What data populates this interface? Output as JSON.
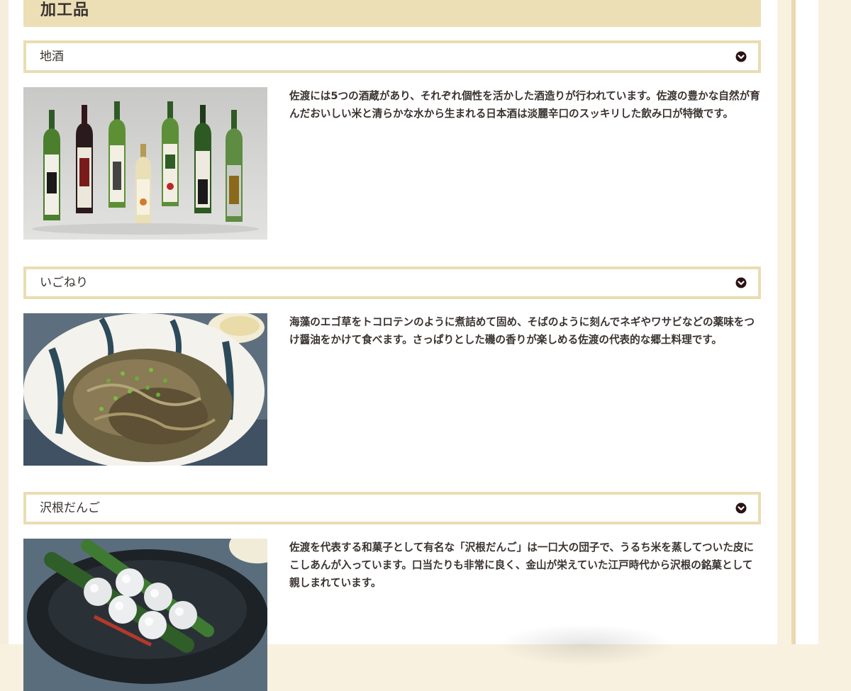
{
  "section": {
    "title": "加工品"
  },
  "items": [
    {
      "title": "地酒",
      "toggle_icon": "chevron-down-circle-icon",
      "image_name": "sake-bottles-photo",
      "description": "佐渡には5つの酒蔵があり、それぞれ個性を活かした酒造りが行われています。佐渡の豊かな自然が育んだおいしい米と清らかな水から生まれる日本酒は淡麗辛口のスッキリした飲み口が特徴です。"
    },
    {
      "title": "いごねり",
      "toggle_icon": "chevron-down-circle-icon",
      "image_name": "igoneri-photo",
      "description": "海藻のエゴ草をトコロテンのように煮詰めて固め、そばのように刻んでネギやワサビなどの薬味をつけ醤油をかけて食べます。さっぱりとした磯の香りが楽しめる佐渡の代表的な郷土料理です。"
    },
    {
      "title": "沢根だんご",
      "toggle_icon": "chevron-down-circle-icon",
      "image_name": "sawane-dango-photo",
      "description": "佐渡を代表する和菓子として有名な「沢根だんご」は一口大の団子で、うるち米を蒸してついた皮にこしあんが入っています。口当たりも非常に良く、金山が栄えていた江戸時代から沢根の銘菓として親しまれています。"
    }
  ],
  "colors": {
    "header_bg": "#ecdfb5",
    "border": "#eadcb3",
    "icon": "#2a1215",
    "text": "#3a3330",
    "side_bg": "#f8f1e0"
  }
}
